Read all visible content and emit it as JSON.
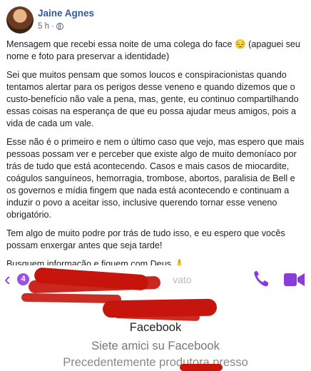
{
  "post": {
    "author": "Jaine Agnes",
    "time": "5 h",
    "dot": "·",
    "paragraphs": [
      "Mensagem que recebi essa noite de uma colega do face 😔 (apaguei seu nome e foto para preservar a identidade)",
      "Sei que muitos pensam que somos loucos e conspiracionistas quando tentamos alertar para os perigos desse veneno e quando dizemos que o custo-benefício não vale a pena, mas, gente, eu continuo compartilhando essas coisas na esperança de que eu possa ajudar meus amigos, pois a vida de cada um vale.",
      "Esse não é o primeiro e nem o último caso que vejo, mas espero que mais pessoas possam ver e perceber que existe algo de muito demoníaco por trás de tudo que está acontecendo. Casos e mais casos de miocardite, coágulos sanguíneos, hemorragia, trombose, abortos, paralisia de Bell e os governos e mídia fingem que nada está acontecendo e continuam a induzir o povo a aceitar isso, inclusive querendo tornar esse veneno obrigatório.",
      "Tem algo de muito podre por trás de tudo isso, e eu espero que vocês possam enxergar antes que seja tarde!",
      "Busquem informação e fiquem com Deus 🙏"
    ]
  },
  "screenshot": {
    "back_icon": "‹",
    "badge_count": "4",
    "partial_text": "vato",
    "title": "Facebook",
    "line1": "Siete amici su Facebook",
    "line2": "Precedentemente produtora presso"
  },
  "colors": {
    "author": "#385898",
    "messenger_purple": "#8a3bdc",
    "scribble_red": "#c5150c"
  }
}
